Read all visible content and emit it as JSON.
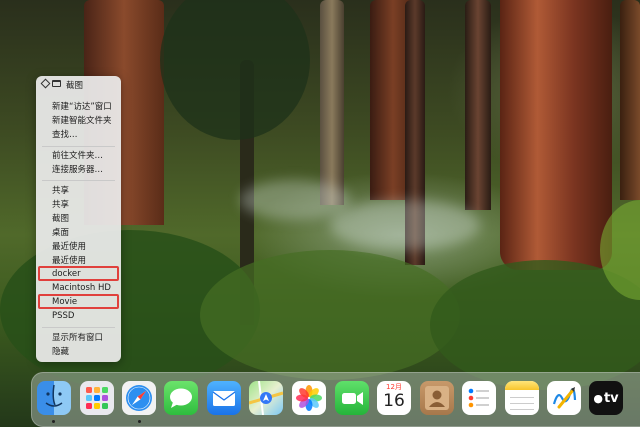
{
  "context_menu": {
    "title": "截图",
    "groups": [
      [
        "新建“访达”窗口",
        "新建智能文件夹",
        "查找…"
      ],
      [
        "前往文件夹…",
        "连接服务器…"
      ],
      [
        "共享",
        "共享",
        "截图",
        "桌面",
        "最近使用",
        "最近使用",
        "docker",
        "Macintosh HD",
        "Movie",
        "PSSD"
      ],
      [
        "显示所有窗口",
        "隐藏"
      ]
    ],
    "highlighted": [
      "docker",
      "Movie"
    ],
    "highlight_color": "#e0403c"
  },
  "dock": {
    "apps": [
      {
        "name": "finder",
        "icon": "finder-icon"
      },
      {
        "name": "launchpad",
        "icon": "launchpad-icon"
      },
      {
        "name": "safari",
        "icon": "compass-icon"
      },
      {
        "name": "messages",
        "icon": "speech-bubble-icon"
      },
      {
        "name": "mail",
        "icon": "envelope-icon"
      },
      {
        "name": "maps",
        "icon": "map-icon"
      },
      {
        "name": "photos",
        "icon": "flower-icon"
      },
      {
        "name": "facetime",
        "icon": "video-camera-icon"
      },
      {
        "name": "calendar",
        "icon": "calendar-icon",
        "month": "12月",
        "day": "16"
      },
      {
        "name": "contacts",
        "icon": "contacts-icon"
      },
      {
        "name": "reminders",
        "icon": "list-icon"
      },
      {
        "name": "notes",
        "icon": "notes-icon"
      },
      {
        "name": "freeform",
        "icon": "freeform-icon"
      },
      {
        "name": "tv",
        "icon": "tv-icon",
        "label": "tv"
      }
    ]
  }
}
